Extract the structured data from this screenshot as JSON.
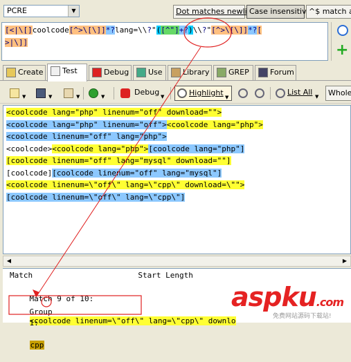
{
  "toolbar_top": {
    "flavor": "PCRE",
    "options": [
      "Dot matches newline",
      "Case insensitive",
      "^$ match at"
    ]
  },
  "regex": {
    "tokens": [
      {
        "t": "[<|\\[]",
        "k": "cls"
      },
      {
        "t": "coolcode",
        "k": "lit"
      },
      {
        "t": "[^>\\[\\]]",
        "k": "cls"
      },
      {
        "t": "*?",
        "k": "clsq"
      },
      {
        "t": "lang=\\\\",
        "k": "lit"
      },
      {
        "t": "?",
        "k": "pun"
      },
      {
        "t": "\"",
        "k": "lit"
      },
      {
        "t": "(",
        "k": "sel"
      },
      {
        "t": "[^\"]",
        "k": "grp"
      },
      {
        "t": "+?",
        "k": "clsq"
      },
      {
        "t": ")",
        "k": "sel"
      },
      {
        "t": "\\\\",
        "k": "lit"
      },
      {
        "t": "?",
        "k": "pun"
      },
      {
        "t": "\"",
        "k": "lit"
      },
      {
        "t": "[^>\\[\\]]",
        "k": "cls"
      },
      {
        "t": "*?",
        "k": "clsq"
      },
      {
        "t": "[",
        "k": "cls"
      },
      {
        "t": "\n",
        "k": "lit"
      },
      {
        "t": ">|\\]]",
        "k": "cls"
      }
    ]
  },
  "tabs": [
    {
      "label": "Create",
      "icon": "create-icon",
      "active": false
    },
    {
      "label": "Test",
      "icon": "test-icon",
      "active": true
    },
    {
      "label": "Debug",
      "icon": "debug-icon",
      "active": false
    },
    {
      "label": "Use",
      "icon": "use-icon",
      "active": false
    },
    {
      "label": "Library",
      "icon": "library-icon",
      "active": false
    },
    {
      "label": "GREP",
      "icon": "grep-icon",
      "active": false
    },
    {
      "label": "Forum",
      "icon": "forum-icon",
      "active": false
    }
  ],
  "toolbar": {
    "debug_label": "Debug",
    "highlight_label": "Highlight",
    "listall_label": "List All",
    "wholeline_label": "Whole l"
  },
  "subject": {
    "lines": [
      [
        {
          "t": "<coolcode lang=\"php\" linenum=\"off\" download=\"\">",
          "h": "y"
        }
      ],
      [
        {
          "t": "<coolcode lang=\"php\" linenum=\"off\">",
          "h": "b"
        },
        {
          "t": "<coolcode lang=\"php\">",
          "h": "y"
        }
      ],
      [
        {
          "t": "<coolcode linenum=\"off\" lang=\"php\">",
          "h": "b"
        }
      ],
      [
        {
          "t": "<coolcode>",
          "h": ""
        },
        {
          "t": "<coolcode lang=\"php\">",
          "h": "y"
        },
        {
          "t": "[coolcode lang=\"php\"]",
          "h": "b"
        }
      ],
      [
        {
          "t": "[coolcode linenum=\"off\" lang=\"mysql\" download=\"\"]",
          "h": "y"
        }
      ],
      [
        {
          "t": "[coolcode]",
          "h": ""
        },
        {
          "t": "[coolcode linenum=\"off\" lang=\"mysql\"]",
          "h": "b"
        }
      ],
      [
        {
          "t": "<coolcode linenum=\\\"off\\\" lang=\\\"cpp\\\" download=\\\"\">",
          "h": "y"
        }
      ],
      [
        {
          "t": "[coolcode linenum=\\\"off\\\" lang=\\\"cpp\\\"]",
          "h": "b"
        }
      ]
    ]
  },
  "results": {
    "header": "Match                       Start Length",
    "match_label": "Match 9 of 10:",
    "match_value": "<coolcode linenum=\\\"off\\\" lang=\\\"cpp\\\" downlo",
    "group_label": "Group",
    "group_num": "1",
    "group_colon": ":",
    "group_value": "cpp"
  },
  "watermark": {
    "brand": "aspku",
    "domain": ".com",
    "sub": "免费网站源码下载站!"
  },
  "colors": {
    "char_class": "#ffc080",
    "quantifier": "#8cc8ff",
    "group": "#66d966",
    "match_yellow": "#ffff33",
    "match_blue": "#8cc8ff",
    "annotation": "#e02020"
  }
}
